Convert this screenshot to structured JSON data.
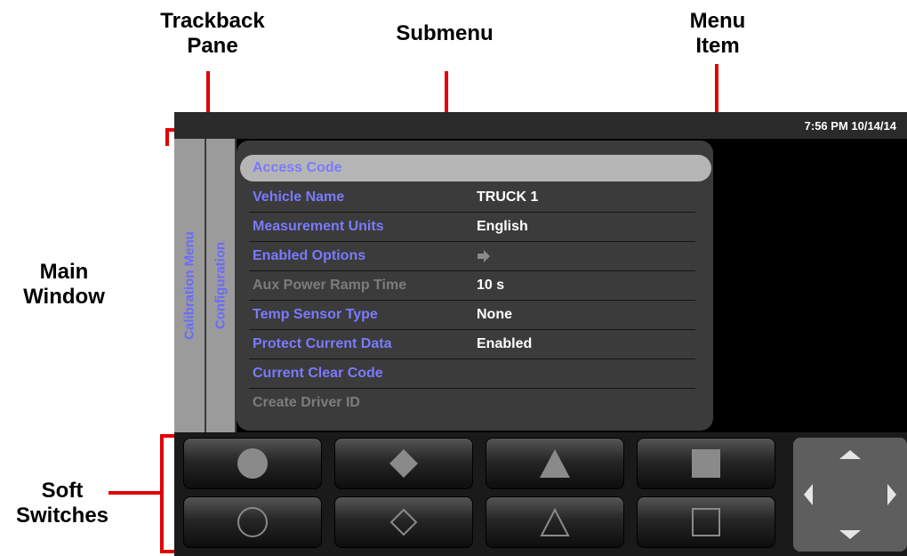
{
  "callouts": {
    "trackback": "Trackback\nPane",
    "submenu": "Submenu",
    "menu_item": "Menu\nItem",
    "main_window": "Main\nWindow",
    "soft_switches": "Soft\nSwitches"
  },
  "status": {
    "clock": "7:56 PM 10/14/14"
  },
  "trackback": [
    {
      "label": "Calibration Menu"
    },
    {
      "label": "Configuration"
    }
  ],
  "menu": {
    "items": [
      {
        "label": "Access Code",
        "value": "",
        "enabled": true,
        "selected": true
      },
      {
        "label": "Vehicle Name",
        "value": "TRUCK 1",
        "enabled": true
      },
      {
        "label": "Measurement Units",
        "value": "English",
        "enabled": true
      },
      {
        "label": "Enabled Options",
        "value": "",
        "enabled": true,
        "submenu": true,
        "icon": "arrow-right-icon"
      },
      {
        "label": "Aux Power Ramp Time",
        "value": "10 s",
        "enabled": false
      },
      {
        "label": "Temp Sensor Type",
        "value": "None",
        "enabled": true
      },
      {
        "label": "Protect Current Data",
        "value": "Enabled",
        "enabled": true
      },
      {
        "label": "Current Clear Code",
        "value": "",
        "enabled": true
      },
      {
        "label": "Create Driver ID",
        "value": "",
        "enabled": false
      }
    ]
  },
  "soft_switches": {
    "top": [
      "circle-filled-icon",
      "diamond-filled-icon",
      "triangle-filled-icon",
      "square-filled-icon"
    ],
    "bottom": [
      "circle-outline-icon",
      "diamond-outline-icon",
      "triangle-outline-icon",
      "square-outline-icon"
    ]
  },
  "dpad": [
    "arrow-up-icon",
    "arrow-left-icon",
    "arrow-right-icon",
    "arrow-down-icon"
  ],
  "colors": {
    "menu_label": "#7a7aff",
    "disabled": "#7c7c7c",
    "callout_line": "#e10000"
  }
}
